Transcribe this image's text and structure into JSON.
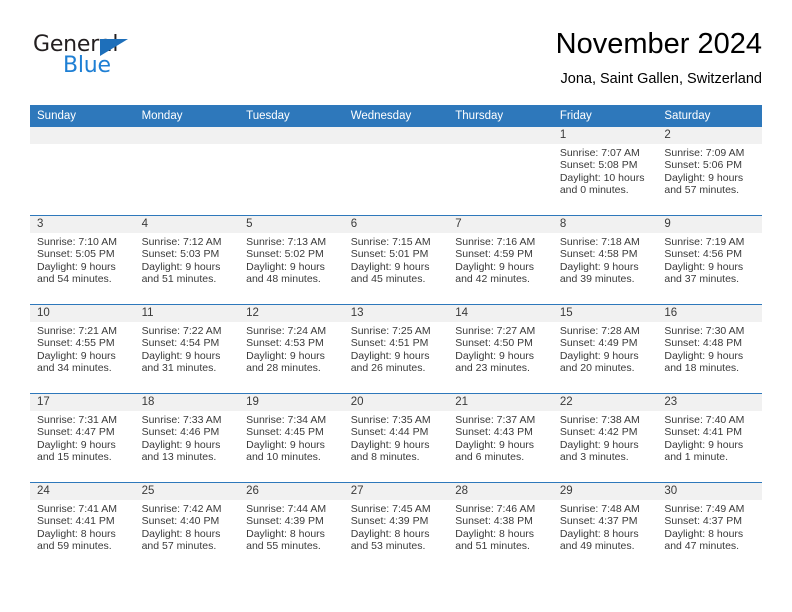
{
  "logo": {
    "word_top": "General",
    "word_bottom": "Blue",
    "triangle_icon": "triangle-icon",
    "color_dark": "#231f20",
    "color_blue": "#1e7fd4"
  },
  "header": {
    "title": "November 2024",
    "subtitle": "Jona, Saint Gallen, Switzerland"
  },
  "theme": {
    "header_bg": "#2e78bb",
    "header_text": "#ffffff",
    "daynum_band_bg": "#f1f1f1",
    "row_separator": "#2e78bb",
    "body_text": "#3a3a3a"
  },
  "calendar": {
    "columns": [
      "Sunday",
      "Monday",
      "Tuesday",
      "Wednesday",
      "Thursday",
      "Friday",
      "Saturday"
    ],
    "weeks": [
      [
        {
          "day": "",
          "lines": []
        },
        {
          "day": "",
          "lines": []
        },
        {
          "day": "",
          "lines": []
        },
        {
          "day": "",
          "lines": []
        },
        {
          "day": "",
          "lines": []
        },
        {
          "day": "1",
          "lines": [
            "Sunrise: 7:07 AM",
            "Sunset: 5:08 PM",
            "Daylight: 10 hours",
            "and 0 minutes."
          ]
        },
        {
          "day": "2",
          "lines": [
            "Sunrise: 7:09 AM",
            "Sunset: 5:06 PM",
            "Daylight: 9 hours",
            "and 57 minutes."
          ]
        }
      ],
      [
        {
          "day": "3",
          "lines": [
            "Sunrise: 7:10 AM",
            "Sunset: 5:05 PM",
            "Daylight: 9 hours",
            "and 54 minutes."
          ]
        },
        {
          "day": "4",
          "lines": [
            "Sunrise: 7:12 AM",
            "Sunset: 5:03 PM",
            "Daylight: 9 hours",
            "and 51 minutes."
          ]
        },
        {
          "day": "5",
          "lines": [
            "Sunrise: 7:13 AM",
            "Sunset: 5:02 PM",
            "Daylight: 9 hours",
            "and 48 minutes."
          ]
        },
        {
          "day": "6",
          "lines": [
            "Sunrise: 7:15 AM",
            "Sunset: 5:01 PM",
            "Daylight: 9 hours",
            "and 45 minutes."
          ]
        },
        {
          "day": "7",
          "lines": [
            "Sunrise: 7:16 AM",
            "Sunset: 4:59 PM",
            "Daylight: 9 hours",
            "and 42 minutes."
          ]
        },
        {
          "day": "8",
          "lines": [
            "Sunrise: 7:18 AM",
            "Sunset: 4:58 PM",
            "Daylight: 9 hours",
            "and 39 minutes."
          ]
        },
        {
          "day": "9",
          "lines": [
            "Sunrise: 7:19 AM",
            "Sunset: 4:56 PM",
            "Daylight: 9 hours",
            "and 37 minutes."
          ]
        }
      ],
      [
        {
          "day": "10",
          "lines": [
            "Sunrise: 7:21 AM",
            "Sunset: 4:55 PM",
            "Daylight: 9 hours",
            "and 34 minutes."
          ]
        },
        {
          "day": "11",
          "lines": [
            "Sunrise: 7:22 AM",
            "Sunset: 4:54 PM",
            "Daylight: 9 hours",
            "and 31 minutes."
          ]
        },
        {
          "day": "12",
          "lines": [
            "Sunrise: 7:24 AM",
            "Sunset: 4:53 PM",
            "Daylight: 9 hours",
            "and 28 minutes."
          ]
        },
        {
          "day": "13",
          "lines": [
            "Sunrise: 7:25 AM",
            "Sunset: 4:51 PM",
            "Daylight: 9 hours",
            "and 26 minutes."
          ]
        },
        {
          "day": "14",
          "lines": [
            "Sunrise: 7:27 AM",
            "Sunset: 4:50 PM",
            "Daylight: 9 hours",
            "and 23 minutes."
          ]
        },
        {
          "day": "15",
          "lines": [
            "Sunrise: 7:28 AM",
            "Sunset: 4:49 PM",
            "Daylight: 9 hours",
            "and 20 minutes."
          ]
        },
        {
          "day": "16",
          "lines": [
            "Sunrise: 7:30 AM",
            "Sunset: 4:48 PM",
            "Daylight: 9 hours",
            "and 18 minutes."
          ]
        }
      ],
      [
        {
          "day": "17",
          "lines": [
            "Sunrise: 7:31 AM",
            "Sunset: 4:47 PM",
            "Daylight: 9 hours",
            "and 15 minutes."
          ]
        },
        {
          "day": "18",
          "lines": [
            "Sunrise: 7:33 AM",
            "Sunset: 4:46 PM",
            "Daylight: 9 hours",
            "and 13 minutes."
          ]
        },
        {
          "day": "19",
          "lines": [
            "Sunrise: 7:34 AM",
            "Sunset: 4:45 PM",
            "Daylight: 9 hours",
            "and 10 minutes."
          ]
        },
        {
          "day": "20",
          "lines": [
            "Sunrise: 7:35 AM",
            "Sunset: 4:44 PM",
            "Daylight: 9 hours",
            "and 8 minutes."
          ]
        },
        {
          "day": "21",
          "lines": [
            "Sunrise: 7:37 AM",
            "Sunset: 4:43 PM",
            "Daylight: 9 hours",
            "and 6 minutes."
          ]
        },
        {
          "day": "22",
          "lines": [
            "Sunrise: 7:38 AM",
            "Sunset: 4:42 PM",
            "Daylight: 9 hours",
            "and 3 minutes."
          ]
        },
        {
          "day": "23",
          "lines": [
            "Sunrise: 7:40 AM",
            "Sunset: 4:41 PM",
            "Daylight: 9 hours",
            "and 1 minute."
          ]
        }
      ],
      [
        {
          "day": "24",
          "lines": [
            "Sunrise: 7:41 AM",
            "Sunset: 4:41 PM",
            "Daylight: 8 hours",
            "and 59 minutes."
          ]
        },
        {
          "day": "25",
          "lines": [
            "Sunrise: 7:42 AM",
            "Sunset: 4:40 PM",
            "Daylight: 8 hours",
            "and 57 minutes."
          ]
        },
        {
          "day": "26",
          "lines": [
            "Sunrise: 7:44 AM",
            "Sunset: 4:39 PM",
            "Daylight: 8 hours",
            "and 55 minutes."
          ]
        },
        {
          "day": "27",
          "lines": [
            "Sunrise: 7:45 AM",
            "Sunset: 4:39 PM",
            "Daylight: 8 hours",
            "and 53 minutes."
          ]
        },
        {
          "day": "28",
          "lines": [
            "Sunrise: 7:46 AM",
            "Sunset: 4:38 PM",
            "Daylight: 8 hours",
            "and 51 minutes."
          ]
        },
        {
          "day": "29",
          "lines": [
            "Sunrise: 7:48 AM",
            "Sunset: 4:37 PM",
            "Daylight: 8 hours",
            "and 49 minutes."
          ]
        },
        {
          "day": "30",
          "lines": [
            "Sunrise: 7:49 AM",
            "Sunset: 4:37 PM",
            "Daylight: 8 hours",
            "and 47 minutes."
          ]
        }
      ]
    ]
  }
}
